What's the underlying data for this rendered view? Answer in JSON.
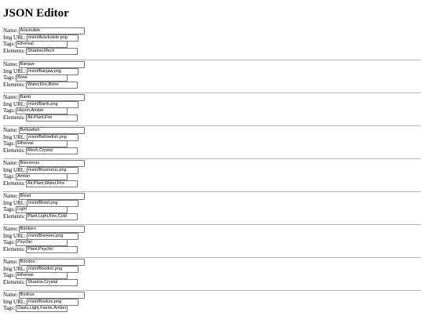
{
  "title": "JSON Editor",
  "labels": {
    "name": "Name:",
    "img": "Img URL:",
    "tags": "Tags:",
    "elements": "Elements:"
  },
  "entries": [
    {
      "name": "Arackulele",
      "img": "msm/Arackulele.png",
      "tags": "Ethereal",
      "elements": "Shadow,Mech"
    },
    {
      "name": "Banjaw",
      "img": "msm/Banjaw.png",
      "tags": "Bone",
      "elements": "Water,Fire,Bone"
    },
    {
      "name": "Barrb",
      "img": "msm/Barrb.png",
      "tags": "Haven,Amber",
      "elements": "Air,Plant,Fire"
    },
    {
      "name": "Bellowfish",
      "img": "msm/Bellowfish.png",
      "tags": "Ethereal",
      "elements": "Mech,Crystal"
    },
    {
      "name": "Bisonorus",
      "img": "msm/Bisonorus.png",
      "tags": "Amber",
      "elements": "Air,Plant,Water,Fire"
    },
    {
      "name": "Blowt",
      "img": "msm/Blowt.png",
      "tags": "Light",
      "elements": "Plant,Light,Fire,Cold"
    },
    {
      "name": "Bonkers",
      "img": "msm/Bonkers.png",
      "tags": "Psychic",
      "elements": "Plant,Psychic"
    },
    {
      "name": "Boodoo",
      "img": "msm/Boodoo.png",
      "tags": "Ethereal",
      "elements": "Shadow,Crystal"
    },
    {
      "name": "Boskus",
      "img": "msm/Boskus.png",
      "tags": "Oasis,Light,Faerie,Amber",
      "elements": ""
    }
  ]
}
